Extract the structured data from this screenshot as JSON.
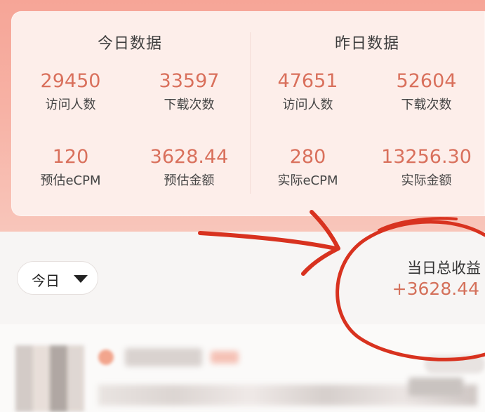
{
  "today": {
    "title": "今日数据",
    "metrics": [
      {
        "value": "29450",
        "label": "访问人数"
      },
      {
        "value": "33597",
        "label": "下载次数"
      },
      {
        "value": "120",
        "label": "预估eCPM"
      },
      {
        "value": "3628.44",
        "label": "预估金额"
      }
    ]
  },
  "yesterday": {
    "title": "昨日数据",
    "metrics": [
      {
        "value": "47651",
        "label": "访问人数"
      },
      {
        "value": "52604",
        "label": "下载次数"
      },
      {
        "value": "280",
        "label": "实际eCPM"
      },
      {
        "value": "13256.30",
        "label": "实际金额"
      }
    ]
  },
  "date_filter": {
    "selected": "今日",
    "icon": "caret-down-icon"
  },
  "income": {
    "label": "当日总收益",
    "value": "+3628.44"
  },
  "colors": {
    "accent": "#d9705c",
    "annotation": "#d8321f"
  }
}
